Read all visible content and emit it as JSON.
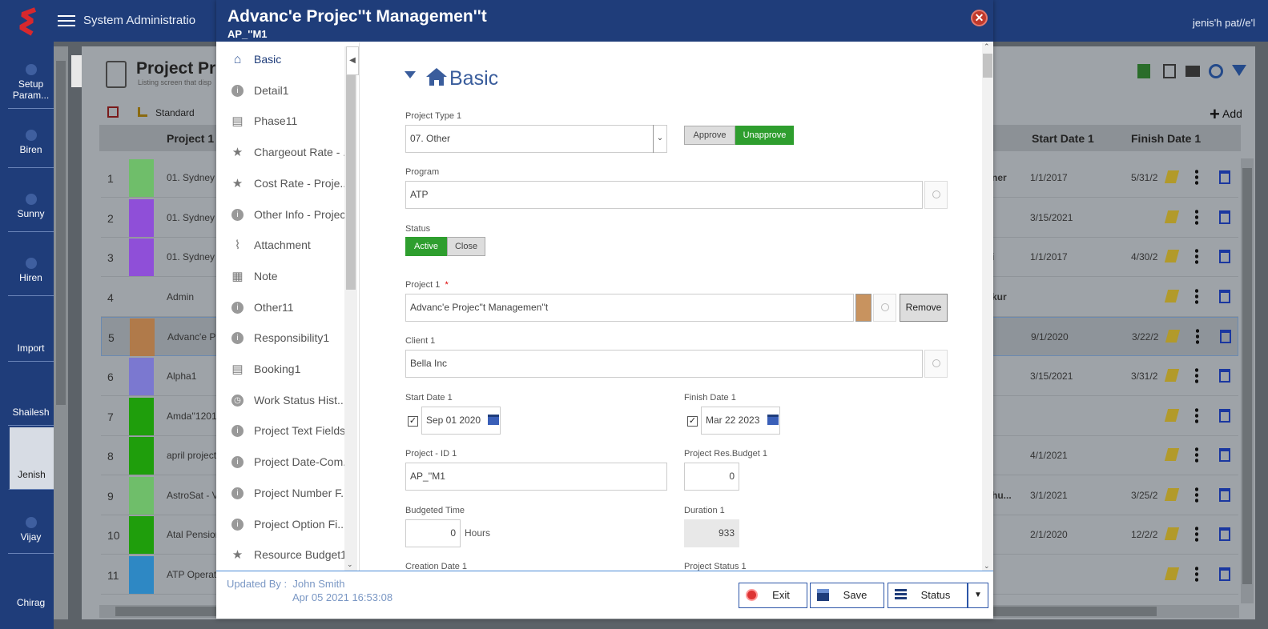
{
  "topbar": {
    "title": "System Administratio",
    "user": "jenis'h pat//e'l"
  },
  "nav": {
    "items": [
      "Setup Param...",
      "Biren",
      "Sunny",
      "Hiren",
      "Import",
      "Shailesh",
      "Jenish",
      "Vijay",
      "Chirag"
    ]
  },
  "background": {
    "page_title": "Project Pro",
    "page_subtitle": "Listing screen that disp",
    "view": "Standard",
    "add_label": "Add",
    "columns": {
      "project": "Project 1",
      "start": "Start Date 1",
      "finish": "Finish Date 1"
    },
    "rows": [
      {
        "num": "1",
        "name": "01. Sydney E",
        "color": "#6fbe6a",
        "start": "1/1/2017",
        "finish": "5/31/2",
        "extra": "ner"
      },
      {
        "num": "2",
        "name": "01. Sydney E",
        "color": "#8f4fd8",
        "start": "3/15/2021",
        "finish": "",
        "extra": ""
      },
      {
        "num": "3",
        "name": "01. Sydney E",
        "color": "#8f4fd8",
        "start": "1/1/2017",
        "finish": "4/30/2",
        "extra": "i"
      },
      {
        "num": "4",
        "name": "Admin",
        "color": "",
        "start": "",
        "finish": "",
        "extra": "kur"
      },
      {
        "num": "5",
        "name": "Advanc'e Pr",
        "color": "#b07a4a",
        "start": "9/1/2020",
        "finish": "3/22/2",
        "extra": ""
      },
      {
        "num": "6",
        "name": "Alpha1",
        "color": "#7b78d0",
        "start": "3/15/2021",
        "finish": "3/31/2",
        "extra": ""
      },
      {
        "num": "7",
        "name": "Amda''1201",
        "color": "#1f9e0c",
        "start": "",
        "finish": "",
        "extra": ""
      },
      {
        "num": "8",
        "name": "april project.",
        "color": "#1f9e0c",
        "start": "4/1/2021",
        "finish": "",
        "extra": ""
      },
      {
        "num": "9",
        "name": "AstroSat - V",
        "color": "#6fbe6a",
        "start": "3/1/2021",
        "finish": "3/25/2",
        "extra": "hu..."
      },
      {
        "num": "10",
        "name": "Atal Pension",
        "color": "#1f9e0c",
        "start": "2/1/2020",
        "finish": "12/2/2",
        "extra": ""
      },
      {
        "num": "11",
        "name": "ATP Operati",
        "color": "#2e88c4",
        "start": "",
        "finish": "",
        "extra": ""
      }
    ]
  },
  "modal": {
    "title": "Advanc'e Projec''t Managemen''t",
    "subtitle": "AP_''M1",
    "close_icon": "close-icon",
    "sidebar": [
      {
        "label": "Basic",
        "icon": "home-icon"
      },
      {
        "label": "Detail1",
        "icon": "info-icon"
      },
      {
        "label": "Phase11",
        "icon": "document-icon"
      },
      {
        "label": "Chargeout Rate - ...",
        "icon": "star-icon"
      },
      {
        "label": "Cost Rate - Proje...",
        "icon": "star-icon"
      },
      {
        "label": "Other Info - Project",
        "icon": "info-icon"
      },
      {
        "label": "Attachment",
        "icon": "paperclip-icon"
      },
      {
        "label": "Note",
        "icon": "note-icon"
      },
      {
        "label": "Other11",
        "icon": "info-icon"
      },
      {
        "label": "Responsibility1",
        "icon": "info-icon"
      },
      {
        "label": "Booking1",
        "icon": "document-icon"
      },
      {
        "label": "Work Status Hist...",
        "icon": "clock-icon"
      },
      {
        "label": "Project Text Fields",
        "icon": "info-icon"
      },
      {
        "label": "Project Date-Com...",
        "icon": "info-icon"
      },
      {
        "label": "Project Number F...",
        "icon": "info-icon"
      },
      {
        "label": "Project Option Fi...",
        "icon": "info-icon"
      },
      {
        "label": "Resource Budget1",
        "icon": "star-icon"
      }
    ],
    "section_title": "Basic",
    "form": {
      "project_type_label": "Project Type 1",
      "project_type_value": "07. Other",
      "approve": "Approve",
      "unapprove": "Unapprove",
      "program_label": "Program",
      "program_value": "ATP",
      "status_label": "Status",
      "status_active": "Active",
      "status_close": "Close",
      "project_label": "Project 1",
      "required_mark": "*",
      "project_value": "Advanc'e Projec''t Managemen''t",
      "project_color": "#c8935f",
      "remove": "Remove",
      "client_label": "Client 1",
      "client_value": "Bella Inc",
      "start_label": "Start Date 1",
      "start_value": "Sep 01 2020",
      "finish_label": "Finish Date 1",
      "finish_value": "Mar 22 2023",
      "project_id_label": "Project - ID 1",
      "project_id_value": "AP_''M1",
      "res_budget_label": "Project Res.Budget 1",
      "res_budget_value": "0",
      "budgeted_time_label": "Budgeted Time",
      "budgeted_time_value": "0",
      "hours": "Hours",
      "duration_label": "Duration 1",
      "duration_value": "933",
      "creation_label": "Creation Date 1",
      "project_status_label": "Project Status 1"
    },
    "footer": {
      "updated_by_label": "Updated By :",
      "updated_by": "John Smith",
      "updated_at": "Apr 05 2021 16:53:08",
      "exit": "Exit",
      "save": "Save",
      "status": "Status"
    }
  },
  "colors": {
    "brand": "#1f3d7a",
    "accent_green": "#2e9e2e",
    "footer_text": "#7a97c4",
    "close_red": "#c0392b"
  }
}
